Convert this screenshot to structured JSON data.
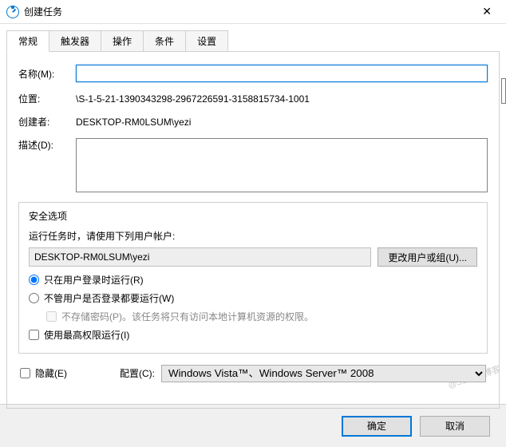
{
  "window": {
    "title": "创建任务"
  },
  "tabs": [
    {
      "label": "常规"
    },
    {
      "label": "触发器"
    },
    {
      "label": "操作"
    },
    {
      "label": "条件"
    },
    {
      "label": "设置"
    }
  ],
  "labels": {
    "name": "名称(M):",
    "location": "位置:",
    "creator": "创建者:",
    "description": "描述(D):",
    "security": "安全选项",
    "runAs": "运行任务时，请使用下列用户帐户:",
    "changeUser": "更改用户或组(U)...",
    "onlyLoggedOn": "只在用户登录时运行(R)",
    "whetherLoggedOn": "不管用户是否登录都要运行(W)",
    "noStorePwd": "不存储密码(P)。该任务将只有访问本地计算机资源的权限。",
    "highestPriv": "使用最高权限运行(I)",
    "hidden": "隐藏(E)",
    "configFor": "配置(C):",
    "ok": "确定",
    "cancel": "取消"
  },
  "values": {
    "name": "",
    "location": "\\S-1-5-21-1390343298-2967226591-3158815734-1001",
    "creator": "DESKTOP-RM0LSUM\\yezi",
    "description": "",
    "account": "DESKTOP-RM0LSUM\\yezi",
    "configSelected": "Windows Vista™、Windows Server™ 2008"
  },
  "watermark": "@51CTO博客"
}
